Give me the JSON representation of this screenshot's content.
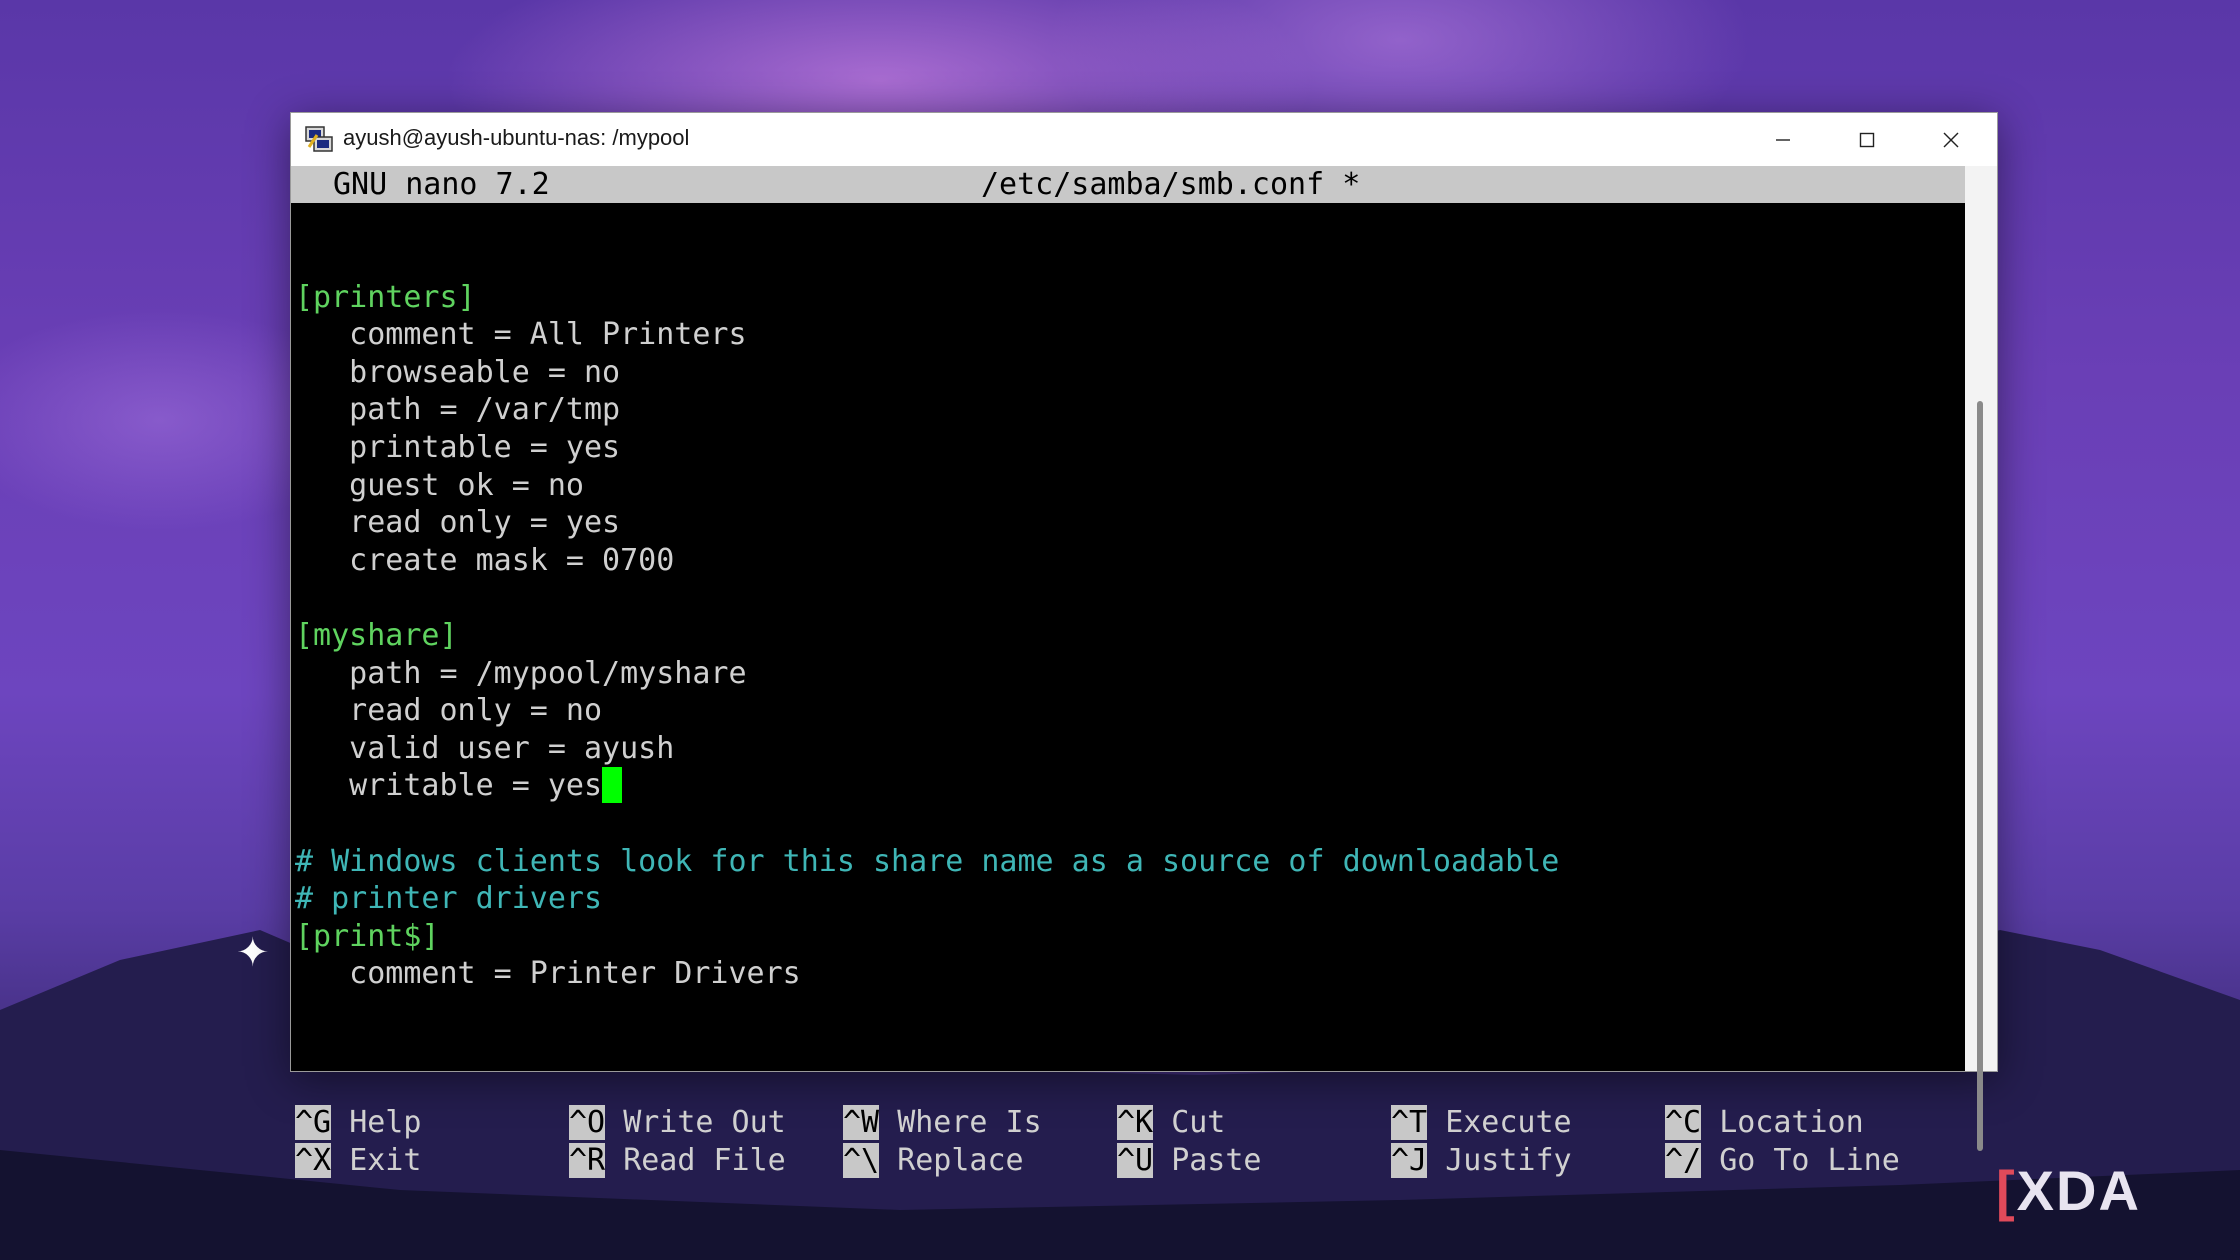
{
  "window": {
    "title": "ayush@ayush-ubuntu-nas: /mypool",
    "icon": "putty-terminal-icon"
  },
  "nano": {
    "version": "GNU nano 7.2",
    "filename": "/etc/samba/smb.conf *"
  },
  "editor_lines": [
    {
      "text": "",
      "style": "white"
    },
    {
      "text": "[printers]",
      "style": "green"
    },
    {
      "text": "   comment = All Printers",
      "style": "white"
    },
    {
      "text": "   browseable = no",
      "style": "white"
    },
    {
      "text": "   path = /var/tmp",
      "style": "white"
    },
    {
      "text": "   printable = yes",
      "style": "white"
    },
    {
      "text": "   guest ok = no",
      "style": "white"
    },
    {
      "text": "   read only = yes",
      "style": "white"
    },
    {
      "text": "   create mask = 0700",
      "style": "white"
    },
    {
      "text": "",
      "style": "white"
    },
    {
      "text": "[myshare]",
      "style": "green"
    },
    {
      "text": "   path = /mypool/myshare",
      "style": "white"
    },
    {
      "text": "   read only = no",
      "style": "white"
    },
    {
      "text": "   valid user = ayush",
      "style": "white"
    },
    {
      "text": "   writable = yes",
      "style": "white",
      "cursor": true
    },
    {
      "text": "",
      "style": "white"
    },
    {
      "text": "# Windows clients look for this share name as a source of downloadable",
      "style": "cyan"
    },
    {
      "text": "# printer drivers",
      "style": "cyan"
    },
    {
      "text": "[print$]",
      "style": "green"
    },
    {
      "text": "   comment = Printer Drivers",
      "style": "white"
    }
  ],
  "shortcuts": {
    "row1": [
      {
        "key": "^G",
        "label": "Help"
      },
      {
        "key": "^O",
        "label": "Write Out"
      },
      {
        "key": "^W",
        "label": "Where Is"
      },
      {
        "key": "^K",
        "label": "Cut"
      },
      {
        "key": "^T",
        "label": "Execute"
      },
      {
        "key": "^C",
        "label": "Location"
      }
    ],
    "row2": [
      {
        "key": "^X",
        "label": "Exit"
      },
      {
        "key": "^R",
        "label": "Read File"
      },
      {
        "key": "^\\",
        "label": "Replace"
      },
      {
        "key": "^U",
        "label": "Paste"
      },
      {
        "key": "^J",
        "label": "Justify"
      },
      {
        "key": "^/",
        "label": "Go To Line"
      }
    ]
  },
  "watermark": "XDA",
  "colors": {
    "header_bg": "#c8c8c8",
    "section": "#5fd35f",
    "comment": "#3fb6b6",
    "cursor": "#00ff00"
  }
}
